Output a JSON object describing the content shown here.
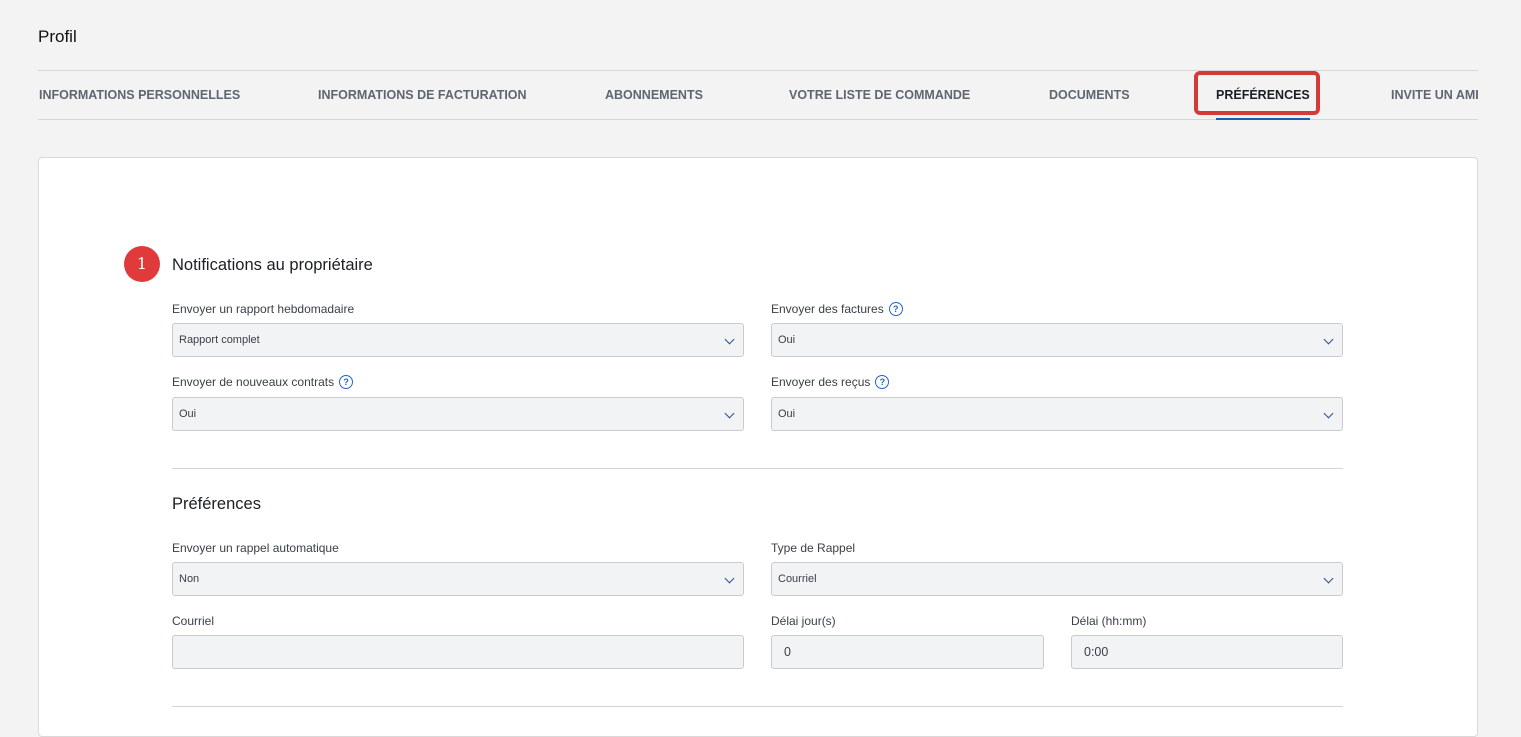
{
  "page": {
    "title": "Profil"
  },
  "tabs": [
    {
      "label": "INFORMATIONS PERSONNELLES"
    },
    {
      "label": "INFORMATIONS DE FACTURATION"
    },
    {
      "label": "ABONNEMENTS"
    },
    {
      "label": "VOTRE LISTE DE COMMANDE"
    },
    {
      "label": "DOCUMENTS"
    },
    {
      "label": "PRÉFÉRENCES",
      "active": true
    },
    {
      "label": "INVITE UN AMI"
    }
  ],
  "annotation": {
    "step": "1",
    "color": "#e03a3a"
  },
  "notifications": {
    "title": "Notifications au propriétaire",
    "weekly_report": {
      "label": "Envoyer un rapport hebdomadaire",
      "value": "Rapport complet"
    },
    "invoices": {
      "label": "Envoyer des factures",
      "value": "Oui"
    },
    "contracts": {
      "label": "Envoyer de nouveaux contrats",
      "value": "Oui"
    },
    "receipts": {
      "label": "Envoyer des reçus",
      "value": "Oui"
    }
  },
  "preferences": {
    "title": "Préférences",
    "auto_reminder": {
      "label": "Envoyer un rappel automatique",
      "value": "Non"
    },
    "reminder_type": {
      "label": "Type de Rappel",
      "value": "Courriel"
    },
    "email": {
      "label": "Courriel",
      "value": ""
    },
    "delay_days": {
      "label": "Délai jour(s)",
      "value": "0"
    },
    "delay_time": {
      "label": "Délai (hh:mm)",
      "value": "0:00"
    }
  },
  "colors": {
    "accent": "#1e5bb8",
    "highlight": "#d33a3a",
    "help": "#2563c9"
  }
}
